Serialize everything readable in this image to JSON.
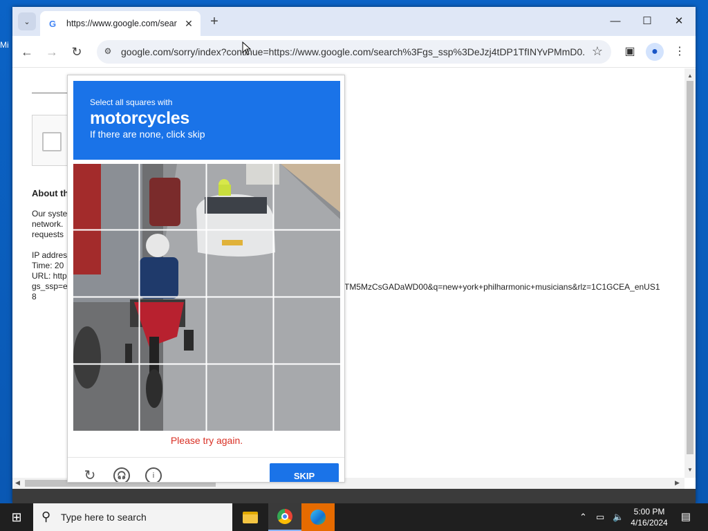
{
  "desktop": {
    "edge_label": "Mi"
  },
  "browser": {
    "tab_title": "https://www.google.com/sear",
    "omnibox_url": "google.com/sorry/index?continue=https://www.google.com/search%3Fgs_ssp%3DeJzj4tDP1TfINYvPMmD0...",
    "window_controls": {
      "minimize": "—",
      "maximize": "☐",
      "close": "✕"
    }
  },
  "behind_page": {
    "heading": "About th",
    "lines": [
      "Our syste",
      "network.",
      "requests",
      "",
      "IP addres",
      "Time: 20",
      "URL: http",
      "gs_ssp=e",
      "8"
    ],
    "url_tail": "TM5MzCsGADaWD00&q=new+york+philharmonic+musicians&rlz=1C1GCEA_enUS1"
  },
  "captcha": {
    "instruction_line1": "Select all squares with",
    "target_object": "motorcycles",
    "instruction_line3": "If there are none, click skip",
    "error_message": "Please try again.",
    "skip_label": "SKIP",
    "grid_rows": 4,
    "grid_cols": 4
  },
  "taskbar": {
    "search_placeholder": "Type here to search",
    "time": "5:00 PM",
    "date": "4/16/2024"
  }
}
